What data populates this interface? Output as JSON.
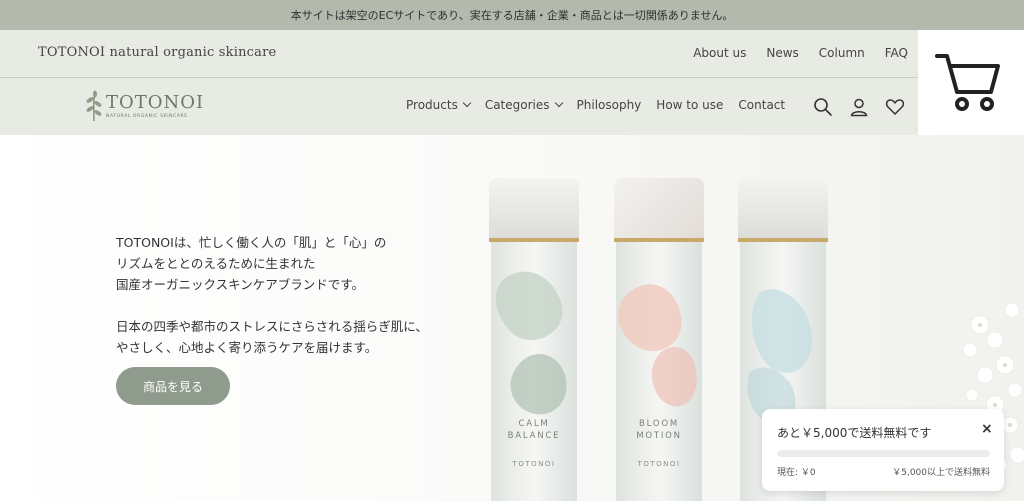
{
  "announcement": "本サイトは架空のECサイトであり、実在する店舗・企業・商品とは一切関係ありません。",
  "header": {
    "brand_text": "TOTONOI natural organic skincare",
    "top_links": [
      "About us",
      "News",
      "Column",
      "FAQ"
    ],
    "logo": {
      "word": "TOTONOI",
      "sub": "NATURAL ORGANIC SKINCARE"
    },
    "nav": [
      {
        "label": "Products",
        "dropdown": true
      },
      {
        "label": "Categories",
        "dropdown": true
      },
      {
        "label": "Philosophy",
        "dropdown": false
      },
      {
        "label": "How to use",
        "dropdown": false
      },
      {
        "label": "Contact",
        "dropdown": false
      }
    ],
    "icons": [
      "search-icon",
      "account-icon",
      "heart-icon",
      "cart-icon"
    ]
  },
  "hero": {
    "lines1": [
      "TOTONOIは、忙しく働く人の「肌」と「心」の",
      "リズムをととのえるために生まれた",
      "国産オーガニックスキンケアブランドです。"
    ],
    "lines2": [
      "日本の四季や都市のストレスにさらされる揺らぎ肌に、",
      "やさしく、心地よく寄り添うケアを届けます。"
    ],
    "cta": "商品を見る",
    "bottles": [
      {
        "line1": "CALM",
        "line2": "BALANCE",
        "brand": "TOTONOI"
      },
      {
        "line1": "BLOOM",
        "line2": "MOTION",
        "brand": "TOTONOI"
      },
      {
        "line1": "",
        "line2": "",
        "brand": "T"
      }
    ]
  },
  "shipping_popup": {
    "message": "あと￥5,000で送料無料です",
    "close": "×",
    "current": "現在: ￥0",
    "threshold": "￥5,000以上で送料無料",
    "progress": 0
  },
  "colors": {
    "announcement_bg": "#b4b9ae",
    "header_bg": "#e7ebe3",
    "accent": "#8f9b8c"
  }
}
